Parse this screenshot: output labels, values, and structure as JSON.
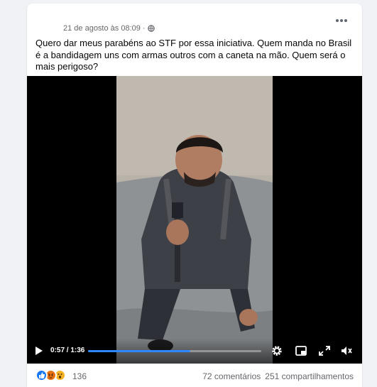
{
  "post": {
    "timestamp": "21 de agosto às 08:09",
    "separator": "·",
    "privacy_icon": "globe-icon",
    "more_icon": "more-options-icon",
    "text": "Quero dar meus parabéns ao STF por essa iniciativa. Quem manda no Brasil é a bandidagem uns com armas outros com a caneta na mão. Quem será o mais perigoso?"
  },
  "video": {
    "time": "0:57 / 1:36",
    "progress": 0.59,
    "icons": [
      "play-icon",
      "settings-gear-icon",
      "picture-in-picture-icon",
      "fullscreen-icon",
      "volume-icon"
    ]
  },
  "footer": {
    "reactions": [
      "like",
      "angry",
      "wow"
    ],
    "reaction_count": "136",
    "comments": "72 comentários",
    "shares": "251 compartilhamentos"
  },
  "colors": {
    "accent": "#2d88ff",
    "like": "#1877f2",
    "angry": "#e9710f",
    "wow": "#f7b125"
  }
}
